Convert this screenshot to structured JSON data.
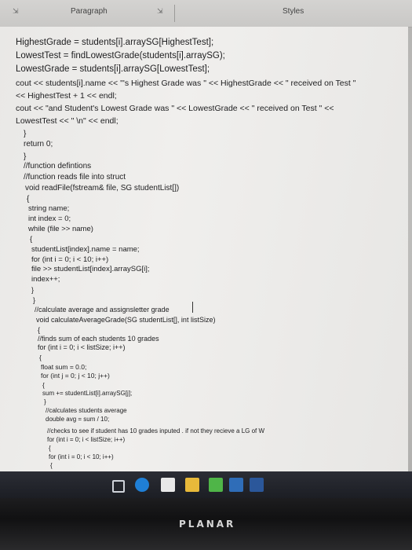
{
  "ribbon": {
    "paragraph_label": "Paragraph",
    "styles_label": "Styles"
  },
  "code_lines": [
    {
      "text": "HighestGrade = students[i].arraySG[HighestTest];"
    },
    {
      "text": "LowestTest = findLowestGrade(students[i].arraySG);"
    },
    {
      "text": "LowestGrade = students[i].arraySG[LowestTest];"
    },
    {
      "text": "cout << students[i].name << \"'s Highest Grade was \" << HighestGrade << \" received on Test \""
    },
    {
      "text": "<< HighestTest + 1 << endl;"
    },
    {
      "text": "cout << \"and Student's Lowest Grade was \" << LowestGrade << \" received on Test \" <<"
    },
    {
      "text": "LowestTest << \" \\n\" << endl;"
    },
    {
      "text": "}"
    },
    {
      "text": "return 0;"
    },
    {
      "text": "}"
    },
    {
      "text": "//function defintions"
    },
    {
      "text": "//function reads file into struct"
    },
    {
      "text": "void readFile(fstream& file, SG studentList[])"
    },
    {
      "text": "{"
    },
    {
      "text": "string name;"
    },
    {
      "text": "int index = 0;"
    },
    {
      "text": "while (file >> name)"
    },
    {
      "text": "{"
    },
    {
      "text": "studentList[index].name = name;"
    },
    {
      "text": "for (int i = 0; i < 10; i++)"
    },
    {
      "text": "file >> studentList[index].arraySG[i];"
    },
    {
      "text": "index++;"
    },
    {
      "text": "}"
    },
    {
      "text": "}"
    },
    {
      "text": "//calculate average and assignsletter grade"
    },
    {
      "text": "void calculateAverageGrade(SG studentList[], int listSize)"
    },
    {
      "text": "{"
    },
    {
      "text": "//finds sum of each students 10 grades"
    },
    {
      "text": "for (int i = 0; i < listSize; i++)"
    },
    {
      "text": "{"
    },
    {
      "text": "float sum = 0.0;"
    },
    {
      "text": "for (int j = 0; j < 10; j++)"
    },
    {
      "text": "{"
    },
    {
      "text": "sum += studentList[i].arraySG[j];"
    },
    {
      "text": "}"
    },
    {
      "text": "//calculates students average"
    },
    {
      "text": "double avg = sum / 10;"
    },
    {
      "text": "//checks to see if student has 10 grades inputed . if not they recieve a LG of W"
    },
    {
      "text": "for (int i = 0; i < listSize; i++)"
    },
    {
      "text": "{"
    },
    {
      "text": "for (int i = 0; i < 10; i++)"
    },
    {
      "text": "{"
    }
  ],
  "monitor_brand": "PLANAR",
  "colors": {
    "taskbar": "#23252c",
    "bezel": "#151516",
    "squiggle": "#c1272d"
  }
}
